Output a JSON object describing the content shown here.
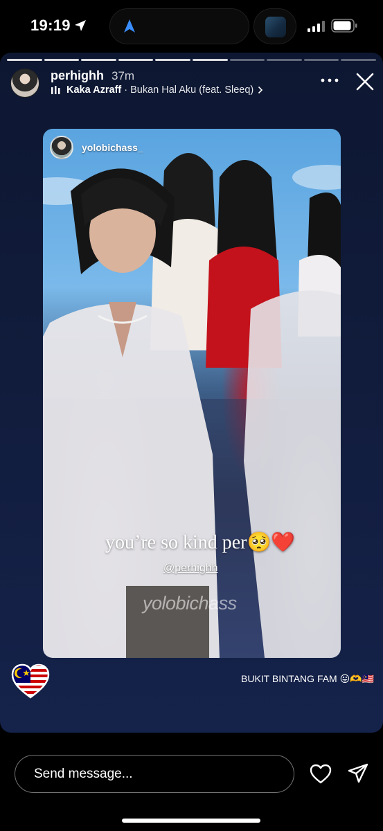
{
  "status_bar": {
    "time": "19:19",
    "icons": [
      "location-arrow-icon",
      "navigation-arrow-icon",
      "album-art-thumb",
      "signal-icon",
      "battery-icon"
    ]
  },
  "story": {
    "progress": {
      "segments": 10,
      "current": 6
    },
    "username": "perhighh",
    "age": "37m",
    "music": {
      "artist": "Kaka Azraff",
      "track": "· Bukan Hal Aku (feat. Sleeq)"
    },
    "shared_post": {
      "username": "yolobichass_",
      "caption": "you’re so kind per🥺❤️",
      "mention": "@perhighh",
      "watermark": "yolobichass"
    },
    "sticker_caption": "BUKIT BINTANG FAM 😛🫶🇲🇾"
  },
  "bottom_bar": {
    "message_placeholder": "Send message..."
  },
  "colors": {
    "background": "#000000",
    "story_bg": "#111c3c",
    "text": "#ffffff"
  }
}
